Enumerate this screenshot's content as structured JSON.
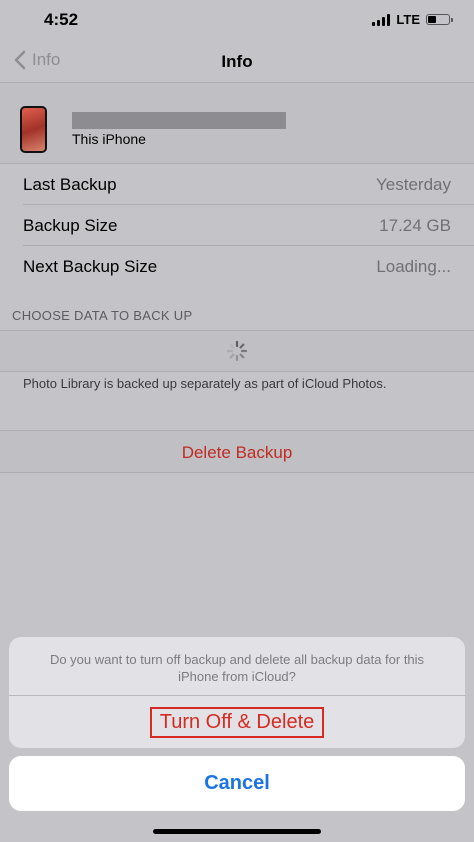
{
  "status_bar": {
    "time": "4:52",
    "network": "LTE"
  },
  "nav": {
    "back_label": "Info",
    "title": "Info"
  },
  "device": {
    "subtitle": "This iPhone"
  },
  "info_rows": [
    {
      "label": "Last Backup",
      "value": "Yesterday"
    },
    {
      "label": "Backup Size",
      "value": "17.24 GB"
    },
    {
      "label": "Next Backup Size",
      "value": "Loading..."
    }
  ],
  "data_section": {
    "header": "CHOOSE DATA TO BACK UP",
    "footer": "Photo Library is backed up separately as part of iCloud Photos."
  },
  "delete_backup": {
    "label": "Delete Backup"
  },
  "action_sheet": {
    "message": "Do you want to turn off backup and delete all backup data for this iPhone from iCloud?",
    "destructive_label": "Turn Off & Delete",
    "cancel_label": "Cancel"
  },
  "colors": {
    "destructive": "#d62a22",
    "accent": "#1a73e8",
    "dimmed_background": "#c4c3c8"
  }
}
